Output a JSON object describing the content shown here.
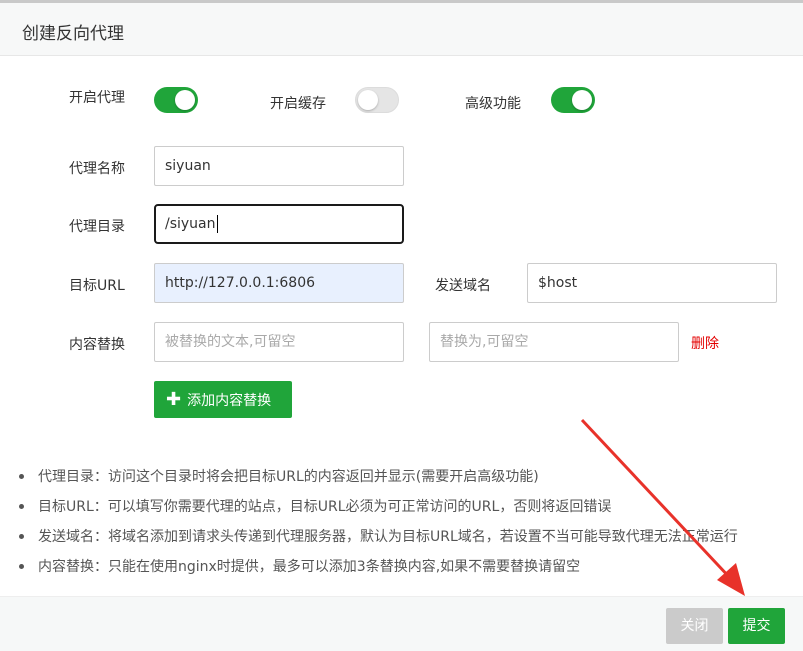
{
  "dialog": {
    "title": "创建反向代理"
  },
  "toggles": {
    "enable_proxy": {
      "label": "开启代理",
      "on": true
    },
    "enable_cache": {
      "label": "开启缓存",
      "on": false
    },
    "advanced": {
      "label": "高级功能",
      "on": true
    }
  },
  "form": {
    "proxy_name": {
      "label": "代理名称",
      "value": "siyuan"
    },
    "proxy_dir": {
      "label": "代理目录",
      "value": "/siyuan"
    },
    "target_url": {
      "label": "目标URL",
      "value": "http://127.0.0.1:6806"
    },
    "send_domain": {
      "label": "发送域名",
      "value": "$host"
    },
    "content_replace": {
      "label": "内容替换",
      "from_placeholder": "被替换的文本,可留空",
      "to_placeholder": "替换为,可留空",
      "delete_label": "删除"
    },
    "add_replace_label": "添加内容替换"
  },
  "notes": [
    "代理目录：访问这个目录时将会把目标URL的内容返回并显示(需要开启高级功能)",
    "目标URL：可以填写你需要代理的站点，目标URL必须为可正常访问的URL，否则将返回错误",
    "发送域名：将域名添加到请求头传递到代理服务器，默认为目标URL域名，若设置不当可能导致代理无法正常运行",
    "内容替换：只能在使用nginx时提供，最多可以添加3条替换内容,如果不需要替换请留空"
  ],
  "footer": {
    "close_label": "关闭",
    "submit_label": "提交"
  },
  "colors": {
    "accent": "#20a53a",
    "danger": "#e30000",
    "annotation_arrow": "#e8322a"
  }
}
